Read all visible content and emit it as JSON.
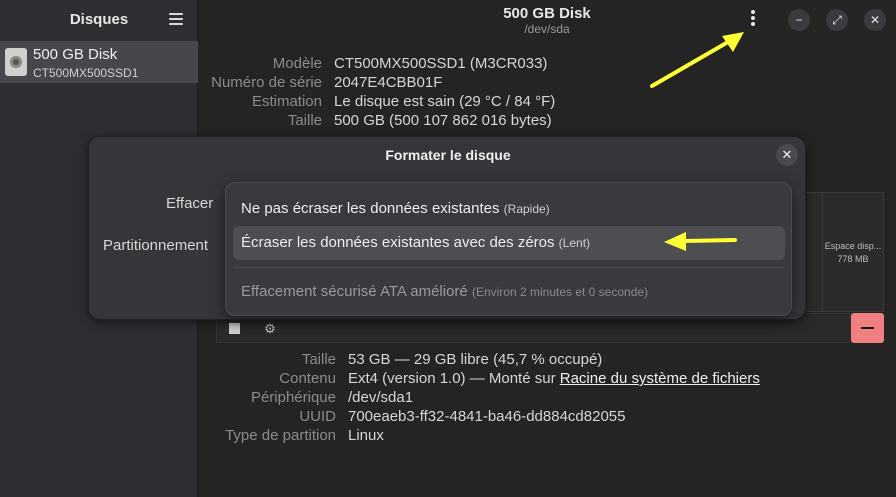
{
  "sidebar": {
    "title": "Disques",
    "items": [
      {
        "name": "500 GB Disk",
        "sub": "CT500MX500SSD1"
      }
    ]
  },
  "header": {
    "title": "500 GB Disk",
    "subtitle": "/dev/sda"
  },
  "disk_info": [
    {
      "label": "Modèle",
      "value": "CT500MX500SSD1 (M3CR033)"
    },
    {
      "label": "Numéro de série",
      "value": "2047E4CBB01F"
    },
    {
      "label": "Estimation",
      "value": "Le disque est sain (29 °C / 84 °F)"
    },
    {
      "label": "Taille",
      "value": "500 GB (500 107 862 016 bytes)"
    }
  ],
  "partition_strip": {
    "label": "Espace disp...",
    "size": "778 MB"
  },
  "dialog": {
    "title": "Formater le disque",
    "close_label": "✕",
    "erase_label": "Effacer",
    "partitioning_label": "Partitionnement",
    "options": [
      {
        "label": "Ne pas écraser les données existantes",
        "hint": "(Rapide)"
      },
      {
        "label": "Écraser les données existantes avec des zéros",
        "hint": "(Lent)"
      },
      {
        "label": "Effacement sécurisé ATA amélioré",
        "hint": "(Environ 2 minutes et 0 seconde)"
      }
    ]
  },
  "partition_info": [
    {
      "label": "Taille",
      "value": "53 GB — 29 GB libre (45,7 % occupé)"
    },
    {
      "label": "Contenu",
      "value": "Ext4 (version 1.0) — Monté sur",
      "link": "Racine du système de fichiers"
    },
    {
      "label": "Périphérique",
      "value": "/dev/sda1"
    },
    {
      "label": "UUID",
      "value": "700eaeb3-ff32-4841-ba46-dd884cd82055"
    },
    {
      "label": "Type de partition",
      "value": "Linux"
    }
  ],
  "icons": {
    "menu": "hamburger-icon",
    "kebab": "kebab-menu-icon",
    "minimize": "minimize-icon",
    "maximize": "maximize-icon",
    "close": "close-icon",
    "stop": "stop-icon",
    "gear": "gear-icon",
    "delete": "minus-icon"
  },
  "colors": {
    "annotation": "#ffff33",
    "delete_button": "#f08080"
  }
}
